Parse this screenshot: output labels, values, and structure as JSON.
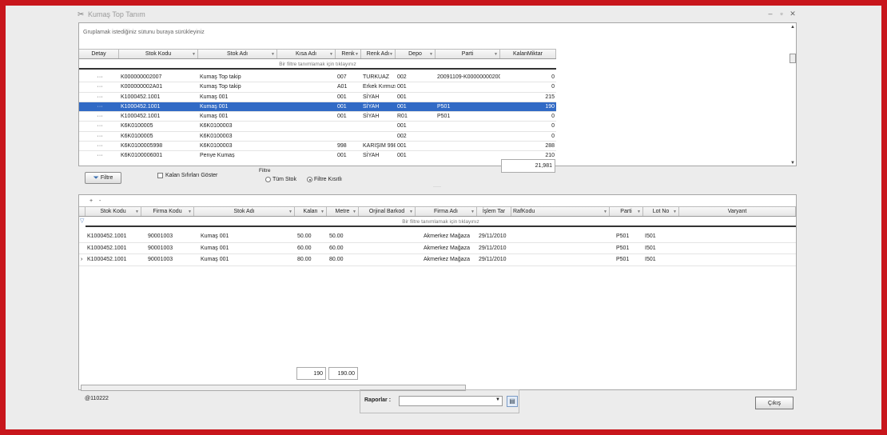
{
  "window": {
    "title": "Kumaş Top Tanım",
    "win_buttons": [
      "–",
      "▫",
      "✕"
    ]
  },
  "top_grid": {
    "group_hint": "Gruplamak istediğiniz sütunu buraya sürükleyiniz",
    "filter_hint": "Bir filtre tanımlamak için tıklayınız",
    "columns": [
      "Detay",
      "Stok Kodu",
      "Stok Adı",
      "Kısa Adı",
      "Renk",
      "Renk Adı",
      "Depo",
      "Parti",
      "KalanMiktar"
    ],
    "rows": [
      [
        "···",
        "K000000002007",
        "Kumaş Top takip",
        "",
        "007",
        "TURKUAZ",
        "002",
        "20091109-K00000000200",
        "0"
      ],
      [
        "···",
        "K000000002A01",
        "Kumaş Top takip",
        "",
        "A01",
        "Erkek Kırmızı",
        "001",
        "",
        "0"
      ],
      [
        "···",
        "K1000452.1001",
        "Kumaş 001",
        "",
        "001",
        "SİYAH",
        "001",
        "",
        "215"
      ],
      [
        "···",
        "K1000452.1001",
        "Kumaş 001",
        "",
        "001",
        "SİYAH",
        "001",
        "P501",
        "190"
      ],
      [
        "···",
        "K1000452.1001",
        "Kumaş 001",
        "",
        "001",
        "SİYAH",
        "R01",
        "P501",
        "0"
      ],
      [
        "···",
        "K6K0100005",
        "K6K0100003",
        "",
        "",
        "",
        "001",
        "",
        "0"
      ],
      [
        "···",
        "K6K0100005",
        "K6K0100003",
        "",
        "",
        "",
        "002",
        "",
        "0"
      ],
      [
        "···",
        "K6K0100005998",
        "K6K0100003",
        "",
        "998",
        "KARIŞIM 998",
        "001",
        "",
        "288"
      ],
      [
        "···",
        "K6K0100006001",
        "Penye Kumaş",
        "",
        "001",
        "SİYAH",
        "001",
        "",
        "210"
      ]
    ],
    "selected_row": 3,
    "total": "21,981"
  },
  "toolbar": {
    "filtre_label": "Filtre",
    "kalan_label": "Kalan Sıfırları Göster",
    "filter_group_label": "Filtre",
    "tum_stok": "Tüm Stok",
    "filtre_kisit": "Filtre Kısıtlı"
  },
  "bottom_grid": {
    "mini_tools": "+ -",
    "filter_hint": "Bir filtre tanımlamak için tıklayınız",
    "columns": [
      "Stok Kodu",
      "Firma Kodu",
      "Stok Adı",
      "Kalan",
      "Metre",
      "Orjinal Barkod",
      "Firma Adı",
      "İşlem Tar",
      "RafKodu",
      "Parti",
      "Lot No",
      "Varyant"
    ],
    "rows": [
      [
        "K1000452.1001",
        "90001003",
        "Kumaş 001",
        "50.00",
        "50.00",
        "",
        "Akmerkez Mağaza",
        "29/11/2010",
        "",
        "P501",
        "I501",
        ""
      ],
      [
        "K1000452.1001",
        "90001003",
        "Kumaş 001",
        "60.00",
        "60.00",
        "",
        "Akmerkez Mağaza",
        "29/11/2010",
        "",
        "P501",
        "I501",
        ""
      ],
      [
        "K1000452.1001",
        "90001003",
        "Kumaş 001",
        "80.00",
        "80.00",
        "",
        "Akmerkez Mağaza",
        "29/11/2010",
        "",
        "P501",
        "I501",
        ""
      ]
    ],
    "totals": {
      "kalan": "190",
      "metre": "190.00"
    }
  },
  "status": {
    "user": "@110222",
    "raporlar_label": "Raporlar :",
    "raporlar_value": "",
    "cikis_label": "Çıkış"
  }
}
